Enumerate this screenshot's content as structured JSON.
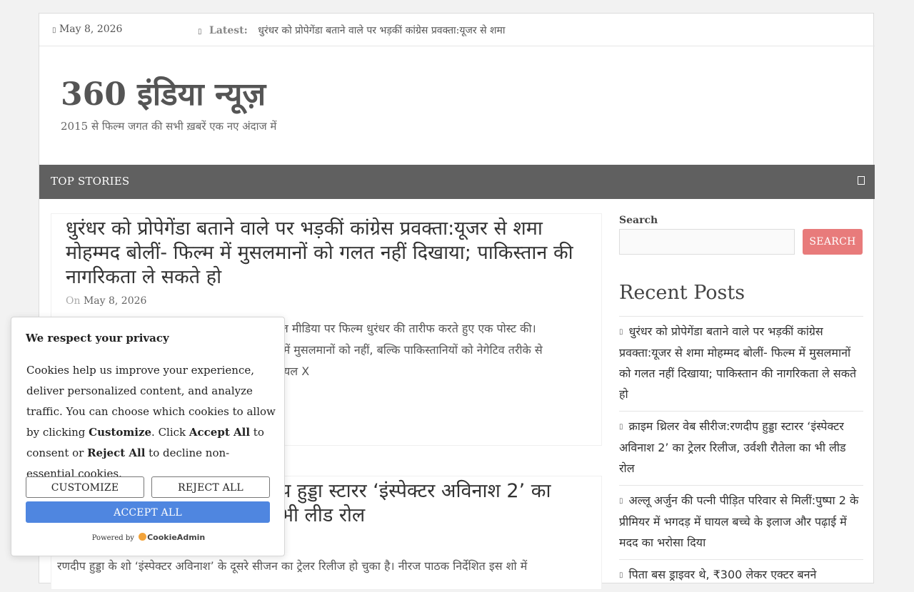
{
  "topbar": {
    "date": "May 8, 2026",
    "latest_label": "Latest:",
    "latest_headline": "धुरंधर को प्रोपेगेंडा बताने वाले पर भड़कीं कांग्रेस प्रवक्ता:यूजर से शमा"
  },
  "brand": {
    "title": "360 इंडिया न्यूज़",
    "tagline": "2015 से फिल्म जगत की सभी ख़बरें एक नए अंदाज में"
  },
  "nav": {
    "item": "TOP STORIES"
  },
  "articles": [
    {
      "title": "धुरंधर को प्रोपेगेंडा बताने वाले पर भड़कीं कांग्रेस प्रवक्ता:यूजर से शमा मोहम्मद बोलीं- फिल्म में मुसलमानों को गलत नहीं दिखाया; पाकिस्तान की नागरिकता ले सकते हो",
      "meta_prefix": "On",
      "date": "May 8, 2026",
      "excerpt_line1": "शल मीडिया पर फिल्म धुरंधर की तारीफ करते हुए एक पोस्ट की।",
      "excerpt_line2": "म में मुसलमानों को नहीं, बल्कि पाकिस्तानियों को नेगेटिव तरीके से",
      "excerpt_line3": "शियल X"
    },
    {
      "title_line1": "प हुड्डा स्टारर ‘इंस्पेक्टर अविनाश 2’ का",
      "title_line2": "भी लीड रोल",
      "excerpt": "रणदीप हुड्डा के शो ‘इंस्पेक्टर अविनाश’ के दूसरे सीजन का ट्रेलर रिलीज हो चुका है। नीरज पाठक निर्देशित इस शो में"
    }
  ],
  "sidebar": {
    "search_label": "Search",
    "search_value": "",
    "search_button": "SEARCH",
    "recent_title": "Recent Posts",
    "recent_posts": [
      "धुरंधर को प्रोपेगेंडा बताने वाले पर भड़कीं कांग्रेस प्रवक्ता:यूजर से शमा मोहम्मद बोलीं- फिल्म में मुसलमानों को गलत नहीं दिखाया; पाकिस्तान की नागरिकता ले सकते हो",
      "क्राइम थ्रिलर वेब सीरीज:रणदीप हुड्डा स्टारर ‘इंस्पेक्टर अविनाश 2’ का ट्रेलर रिलीज, उर्वशी रौतेला का भी लीड रोल",
      "अल्लू अर्जुन की पत्नी पीड़ित परिवार से मिलीं:पुष्पा 2 के प्रीमियर में भगदड़ में घायल बच्चे के इलाज और पढ़ाई में मदद का भरोसा दिया",
      "पिता बस ड्राइवर थे, ₹300 लेकर एक्टर बनने"
    ]
  },
  "cookie": {
    "title": "We respect your privacy",
    "text_1": "Cookies help us improve your experience, deliver personalized content, and analyze traffic. You can choose which cookies to allow by clicking ",
    "strong_customize": "Customize",
    "text_2": ". Click ",
    "strong_accept": "Accept All",
    "text_3": " to consent or ",
    "strong_reject": "Reject All",
    "text_4": " to decline non-essential cookies.",
    "customize_button": "CUSTOMIZE",
    "reject_button": "REJECT ALL",
    "accept_button": "ACCEPT ALL",
    "powered_by": "Powered by",
    "powered_brand": "CookieAdmin"
  },
  "colors": {
    "nav_bg": "#606060",
    "search_button": "#e87b7b",
    "accept_button": "#4f86e0"
  }
}
